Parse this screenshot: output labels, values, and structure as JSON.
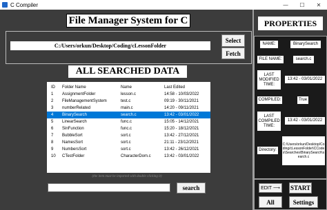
{
  "window": {
    "title": "C Compiler",
    "controls": [
      "—",
      "☐",
      "✕"
    ]
  },
  "main": {
    "title": "File Manager System for C",
    "path": "C:/Users/orkun/Desktop/Coding/cLessonFolder",
    "select_label": "Select",
    "fetch_label": "Fetch",
    "section_title": "ALL SEARCHED DATA",
    "columns": {
      "id": "ID",
      "folder": "Folder Name",
      "name": "Name",
      "date": "Last Edited"
    },
    "rows": [
      {
        "id": "1",
        "folder": "AssignmentFolder",
        "name": "lesson.c",
        "date": "14:58 - 10/03/2022"
      },
      {
        "id": "2",
        "folder": "FileManagementSystem",
        "name": "test.c",
        "date": "09:19 - 30/11/2021"
      },
      {
        "id": "3",
        "folder": "numberRelated",
        "name": "main.c",
        "date": "14:20 - 09/11/2021"
      },
      {
        "id": "4",
        "folder": "BinarySearch",
        "name": "search.c",
        "date": "13:42 - 03/01/2022"
      },
      {
        "id": "5",
        "folder": "LinearSearch",
        "name": "func.c",
        "date": "15:05 - 14/12/2021"
      },
      {
        "id": "6",
        "folder": "SinFunction",
        "name": "func.c",
        "date": "15:20 - 18/12/2021"
      },
      {
        "id": "7",
        "folder": "BubbleSort",
        "name": "sort.c",
        "date": "13:42 - 27/12/2021"
      },
      {
        "id": "8",
        "folder": "NamesSort",
        "name": "sort.c",
        "date": "21:11 - 23/12/2021"
      },
      {
        "id": "9",
        "folder": "NumbersSort",
        "name": "sort.c",
        "date": "13:42 - 26/12/2021"
      },
      {
        "id": "10",
        "folder": "CTestFolder",
        "name": "CharacterDom.c",
        "date": "13:42 - 03/01/2022"
      }
    ],
    "selected_row": 4,
    "hint": "(the item must be imported with double clicking it)",
    "search_value": "",
    "search_label": "search"
  },
  "properties": {
    "title": "PROPERTIES",
    "name_label": "NAME:",
    "name_value": "BinarySearch",
    "filename_label": "FILE NAME:",
    "filename_value": "search.c",
    "lastmod_label": "LAST MODIFIED TIME:",
    "lastmod_value": "13:42 - 03/01/2022",
    "compiled_label": "COMPILED:",
    "compiled_value": "True",
    "lastcomp_label": "LAST COMPILED TIME:",
    "lastcomp_value": "13:42 - 03/01/2022",
    "directory_label": "Directory:",
    "directory_value": "C:/Users/orkun/Desktop/Coding/cLessonFolder\\CCodes\\Searches\\BinarySearch\\search.c",
    "edit_label": "EDIT",
    "start_label": "START",
    "all_label": "All",
    "settings_label": "Settings"
  },
  "colors": {
    "background": "#3c3c3c",
    "panel": "#1a1a1a",
    "selection": "#0078d7"
  }
}
